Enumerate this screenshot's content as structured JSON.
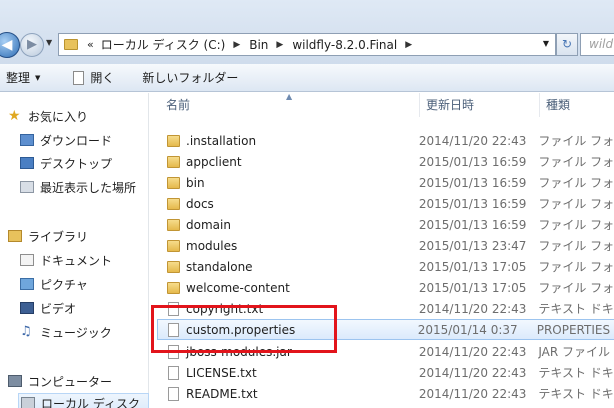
{
  "address": {
    "chevron": "«",
    "crumbs": [
      "ローカル ディスク (C:)",
      "Bin",
      "wildfly-8.2.0.Final"
    ],
    "search_placeholder": "wild"
  },
  "toolbar": {
    "organize_label": "整理",
    "open_label": "開く",
    "new_folder_label": "新しいフォルダー"
  },
  "nav": {
    "favorites": "お気に入り",
    "downloads": "ダウンロード",
    "desktop": "デスクトップ",
    "recent": "最近表示した場所",
    "libraries": "ライブラリ",
    "documents": "ドキュメント",
    "pictures": "ピクチャ",
    "videos": "ビデオ",
    "music": "ミュージック",
    "computer": "コンピューター",
    "local_disk": "ローカル ディスク"
  },
  "columns": {
    "name": "名前",
    "date": "更新日時",
    "type": "種類"
  },
  "files": [
    {
      "name": ".installation",
      "date": "2014/11/20 22:43",
      "type": "ファイル フォ",
      "kind": "folder"
    },
    {
      "name": "appclient",
      "date": "2015/01/13 16:59",
      "type": "ファイル フォ",
      "kind": "folder"
    },
    {
      "name": "bin",
      "date": "2015/01/13 16:59",
      "type": "ファイル フォ",
      "kind": "folder"
    },
    {
      "name": "docs",
      "date": "2015/01/13 16:59",
      "type": "ファイル フォ",
      "kind": "folder"
    },
    {
      "name": "domain",
      "date": "2015/01/13 16:59",
      "type": "ファイル フォ",
      "kind": "folder"
    },
    {
      "name": "modules",
      "date": "2015/01/13 23:47",
      "type": "ファイル フォ",
      "kind": "folder"
    },
    {
      "name": "standalone",
      "date": "2015/01/13 17:05",
      "type": "ファイル フォ",
      "kind": "folder"
    },
    {
      "name": "welcome-content",
      "date": "2015/01/13 17:05",
      "type": "ファイル フォ",
      "kind": "folder"
    },
    {
      "name": "copyright.txt",
      "date": "2014/11/20 22:43",
      "type": "テキスト ドキ",
      "kind": "file"
    },
    {
      "name": "custom.properties",
      "date": "2015/01/14 0:37",
      "type": "PROPERTIES",
      "kind": "file"
    },
    {
      "name": "jboss-modules.jar",
      "date": "2014/11/20 22:43",
      "type": "JAR ファイル",
      "kind": "file"
    },
    {
      "name": "LICENSE.txt",
      "date": "2014/11/20 22:43",
      "type": "テキスト ドキ",
      "kind": "file"
    },
    {
      "name": "README.txt",
      "date": "2014/11/20 22:43",
      "type": "テキスト ドキ",
      "kind": "file"
    }
  ],
  "colors": {
    "highlight_box": "#e2141b",
    "selection": "#dbeafc"
  }
}
